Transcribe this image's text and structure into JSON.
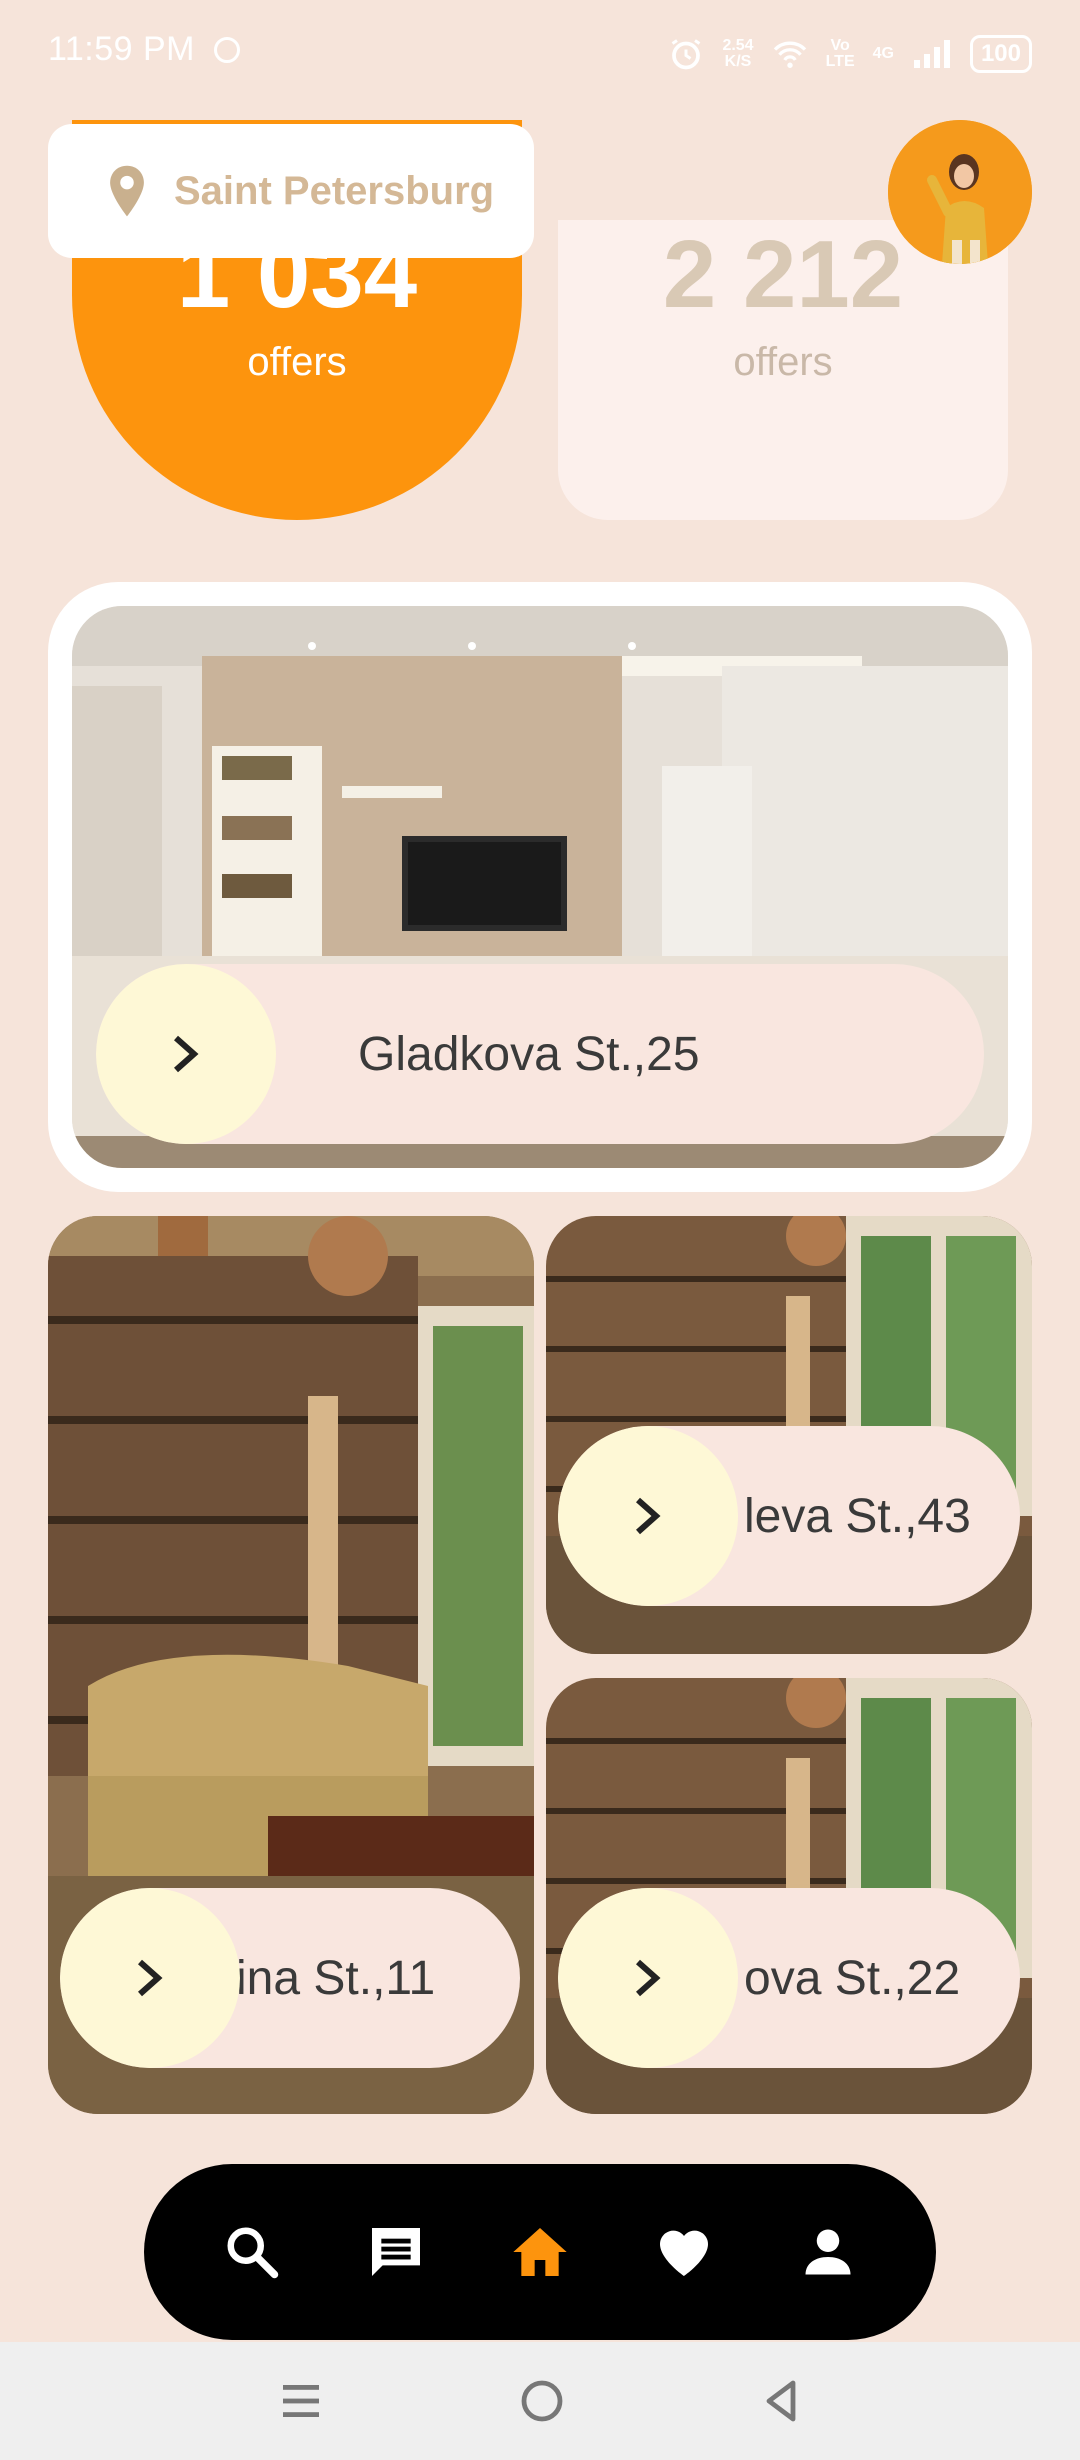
{
  "status_bar": {
    "time": "11:59 PM",
    "speed_top": "2.54",
    "speed_bottom": "K/S",
    "volte_top": "Vo",
    "volte_bottom": "LTE",
    "network": "4G",
    "battery": "100"
  },
  "header": {
    "location": "Saint Petersburg",
    "location_icon": "map-pin-icon",
    "avatar": "user-avatar"
  },
  "offers": [
    {
      "count": "1 034",
      "label": "offers"
    },
    {
      "count": "2 212",
      "label": "offers"
    }
  ],
  "listings": [
    {
      "address": "Gladkova St.,25"
    },
    {
      "address": "ina St.,11"
    },
    {
      "address": "leva St.,43"
    },
    {
      "address": "ova St.,22"
    }
  ],
  "nav": {
    "items": [
      "search-icon",
      "chat-icon",
      "home-icon",
      "heart-icon",
      "profile-icon"
    ],
    "active": "home-icon"
  },
  "colors": {
    "background": "#f6e4da",
    "accent": "#fd940d",
    "nav_bg": "#000000",
    "pill_circle": "#fef8d6"
  }
}
